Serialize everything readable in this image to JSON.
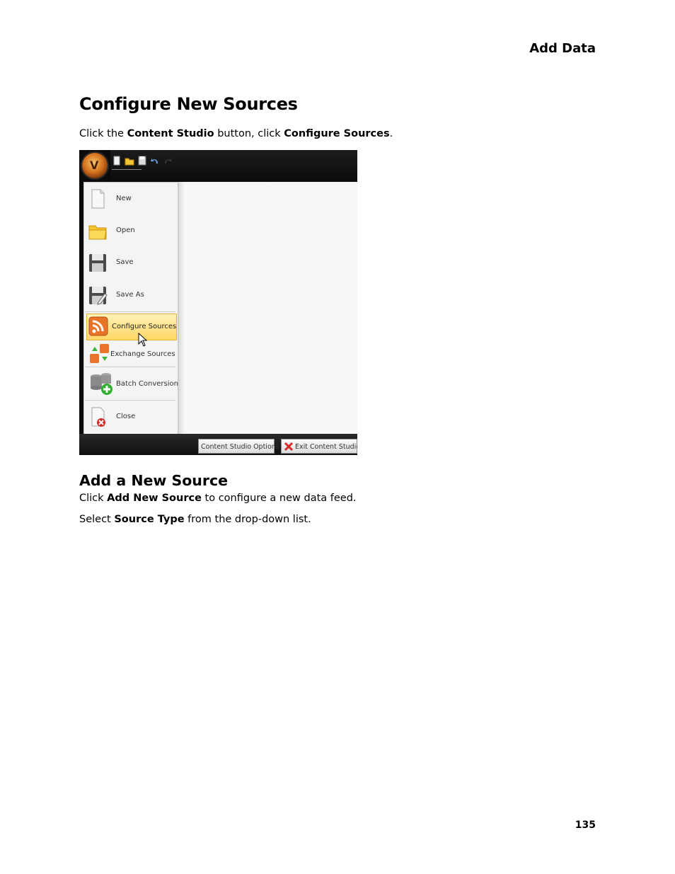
{
  "header": {
    "title": "Add Data"
  },
  "section1": {
    "heading": "Configure New Sources",
    "instruction": {
      "t1": "Click the ",
      "b1": "Content Studio",
      "t2": " button, click ",
      "b2": "Configure Sources",
      "t3": "."
    }
  },
  "screenshot": {
    "menu_items": [
      {
        "label": "New",
        "icon": "new-document-icon"
      },
      {
        "label": "Open",
        "icon": "folder-icon"
      },
      {
        "label": "Save",
        "icon": "floppy-disk-icon"
      },
      {
        "label": "Save As",
        "icon": "save-as-icon"
      },
      {
        "label": "Configure Sources",
        "icon": "rss-feed-icon"
      },
      {
        "label": "Exchange Sources",
        "icon": "exchange-feeds-icon"
      },
      {
        "label": "Batch Conversion",
        "icon": "batch-conversion-icon"
      },
      {
        "label": "Close",
        "icon": "close-document-icon"
      }
    ],
    "buttons": {
      "options": "Content Studio Options",
      "exit": "Exit Content Studio"
    },
    "colors": {
      "highlight": "#ffd766",
      "rss_orange": "#e8742a"
    }
  },
  "section2": {
    "heading": "Add a New Source",
    "p1": {
      "t1": "Click ",
      "b1": "Add New Source",
      "t2": " to configure a new data feed."
    },
    "p2": {
      "t1": "Select ",
      "b1": "Source Type",
      "t2": " from the drop-down list."
    }
  },
  "footer": {
    "page_number": "135"
  }
}
